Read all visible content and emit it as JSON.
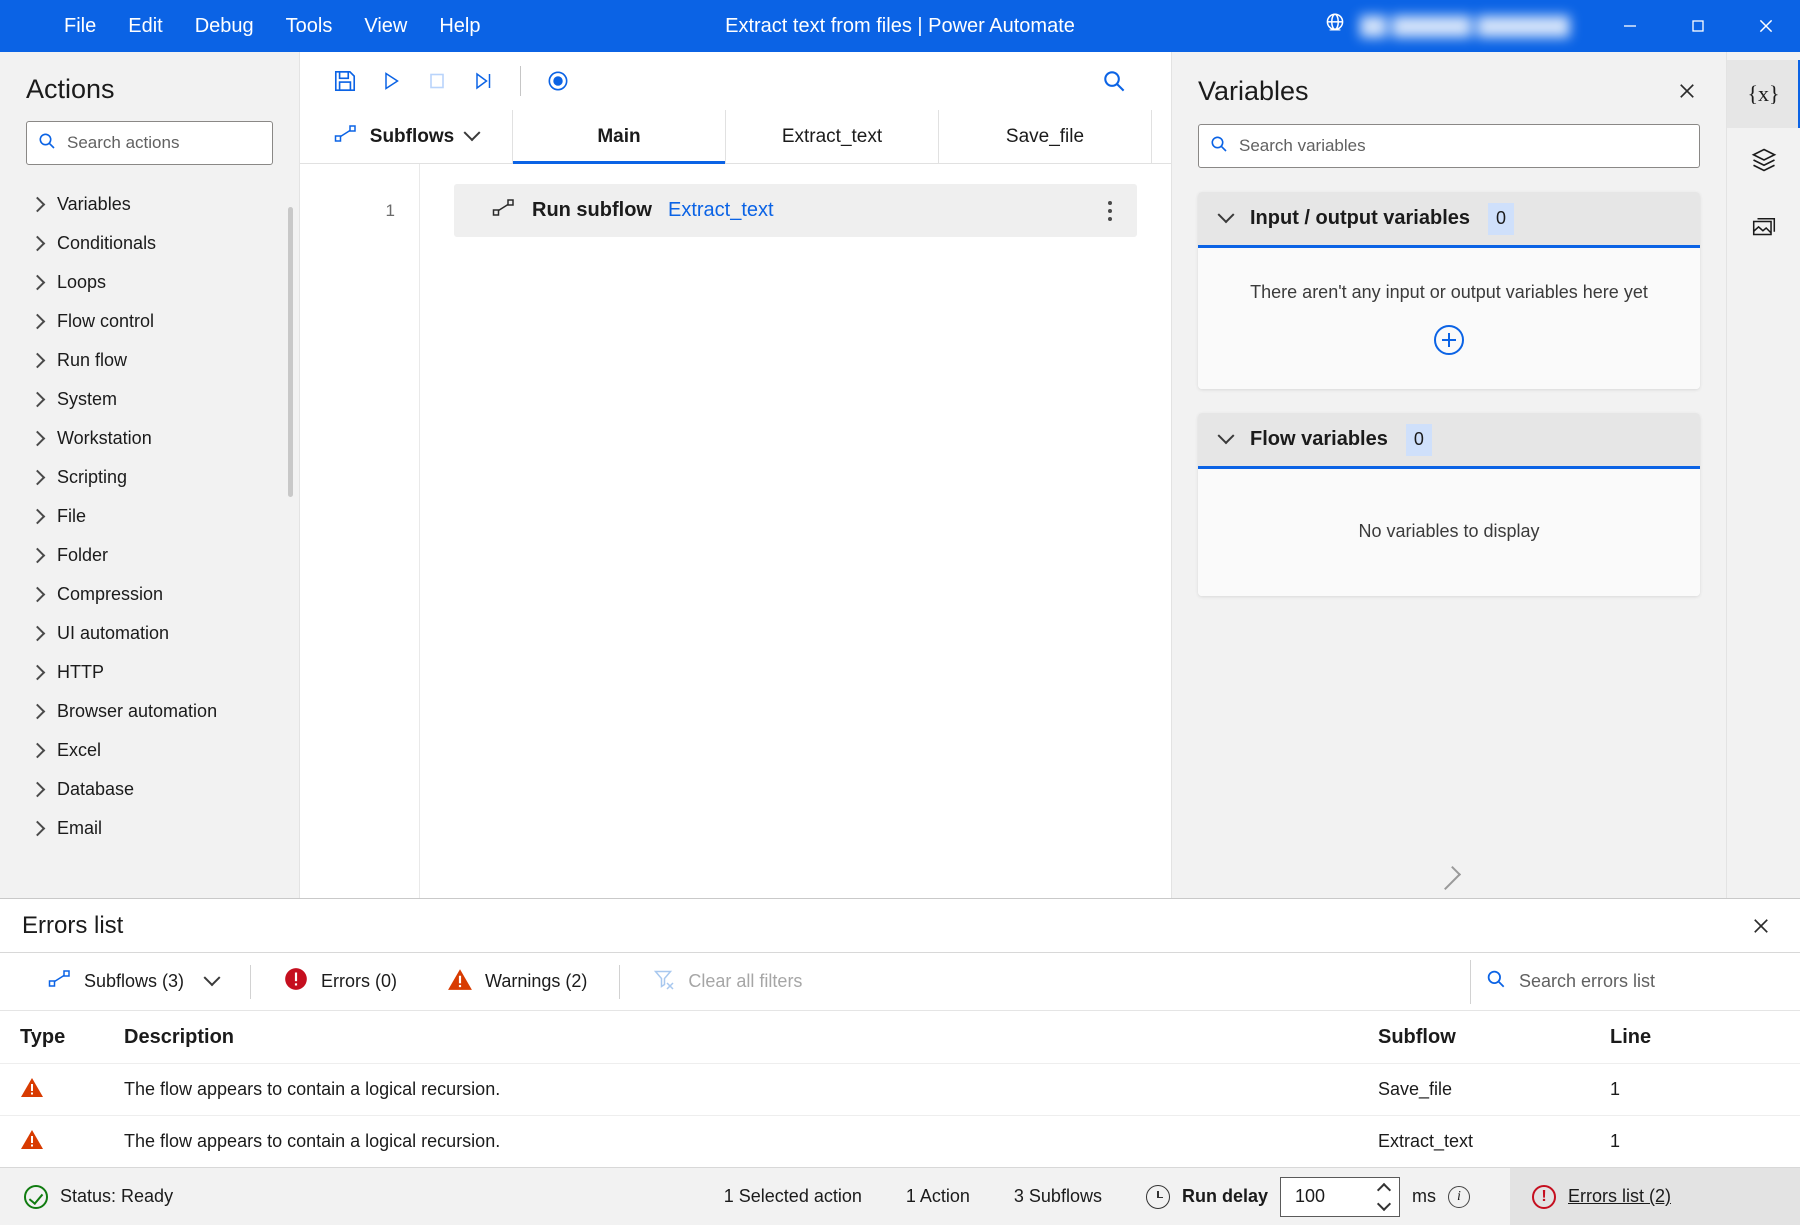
{
  "titlebar": {
    "menus": [
      "File",
      "Edit",
      "Debug",
      "Tools",
      "View",
      "Help"
    ],
    "document_title": "Extract text from files | Power Automate",
    "account_name": "██ ██████ ███████",
    "globe_icon": "globe-icon",
    "minimize_icon": "minimize-icon",
    "maximize_icon": "maximize-icon",
    "close_icon": "close-icon"
  },
  "actions_pane": {
    "title": "Actions",
    "search_placeholder": "Search actions",
    "search_value": "",
    "groups": [
      "Variables",
      "Conditionals",
      "Loops",
      "Flow control",
      "Run flow",
      "System",
      "Workstation",
      "Scripting",
      "File",
      "Folder",
      "Compression",
      "UI automation",
      "HTTP",
      "Browser automation",
      "Excel",
      "Database",
      "Email"
    ]
  },
  "toolbar": {
    "buttons": [
      {
        "name": "save-button",
        "icon": "save-icon"
      },
      {
        "name": "run-button",
        "icon": "play-icon"
      },
      {
        "name": "stop-button",
        "icon": "stop-icon"
      },
      {
        "name": "run-next-action-button",
        "icon": "step-over-icon"
      },
      {
        "name": "recorder-button",
        "icon": "record-icon"
      }
    ],
    "search_icon": "search-icon"
  },
  "tabs": {
    "subflows_label": "Subflows",
    "subflows_icon": "subflow-icon",
    "items": [
      {
        "label": "Main",
        "active": true
      },
      {
        "label": "Extract_text",
        "active": false
      },
      {
        "label": "Save_file",
        "active": false
      }
    ]
  },
  "canvas": {
    "rows": [
      {
        "line": "1",
        "icon": "subflow-icon",
        "label": "Run subflow",
        "argument": "Extract_text",
        "more_icon": "more-options-icon"
      }
    ]
  },
  "variables_pane": {
    "title": "Variables",
    "close_icon": "close-icon",
    "search_placeholder": "Search variables",
    "search_value": "",
    "sections": [
      {
        "title": "Input / output variables",
        "count": "0",
        "empty_text": "There aren't any input or output variables here yet",
        "has_add": true,
        "add_icon": "add-icon"
      },
      {
        "title": "Flow variables",
        "count": "0",
        "empty_text": "No variables to display",
        "has_add": false
      }
    ]
  },
  "rail": {
    "items": [
      {
        "name": "variables-rail-button",
        "icon": "variables-braces-icon",
        "glyph": "{x}",
        "active": true
      },
      {
        "name": "ui-elements-rail-button",
        "icon": "layers-icon",
        "active": false
      },
      {
        "name": "images-rail-button",
        "icon": "image-icon",
        "active": false
      }
    ]
  },
  "errors_panel": {
    "title": "Errors list",
    "close_icon": "close-icon",
    "filters": {
      "subflows_label": "Subflows (3)",
      "subflows_icon": "subflow-icon",
      "errors_label": "Errors (0)",
      "errors_icon": "error-icon",
      "warnings_label": "Warnings (2)",
      "warnings_icon": "warning-icon",
      "clear_label": "Clear all filters",
      "clear_icon": "clear-filter-icon"
    },
    "search_placeholder": "Search errors list",
    "search_value": "",
    "columns": [
      "Type",
      "Description",
      "Subflow",
      "Line"
    ],
    "rows": [
      {
        "type_icon": "warning-icon",
        "description": "The flow appears to contain a logical recursion.",
        "subflow": "Save_file",
        "line": "1"
      },
      {
        "type_icon": "warning-icon",
        "description": "The flow appears to contain a logical recursion.",
        "subflow": "Extract_text",
        "line": "1"
      }
    ]
  },
  "statusbar": {
    "status_icon": "status-ready-icon",
    "status_text": "Status: Ready",
    "selected_action": "1 Selected action",
    "action_count": "1 Action",
    "subflow_count": "3 Subflows",
    "run_delay_icon": "clock-icon",
    "run_delay_label": "Run delay",
    "run_delay_value": "100",
    "run_delay_unit": "ms",
    "info_icon": "info-icon",
    "errors_link_icon": "error-icon",
    "errors_link_label": "Errors list (2)"
  },
  "colors": {
    "brand_blue": "#0b63e5",
    "warning_orange": "#d83b01",
    "error_red": "#c50f1f",
    "success_green": "#107c10"
  }
}
